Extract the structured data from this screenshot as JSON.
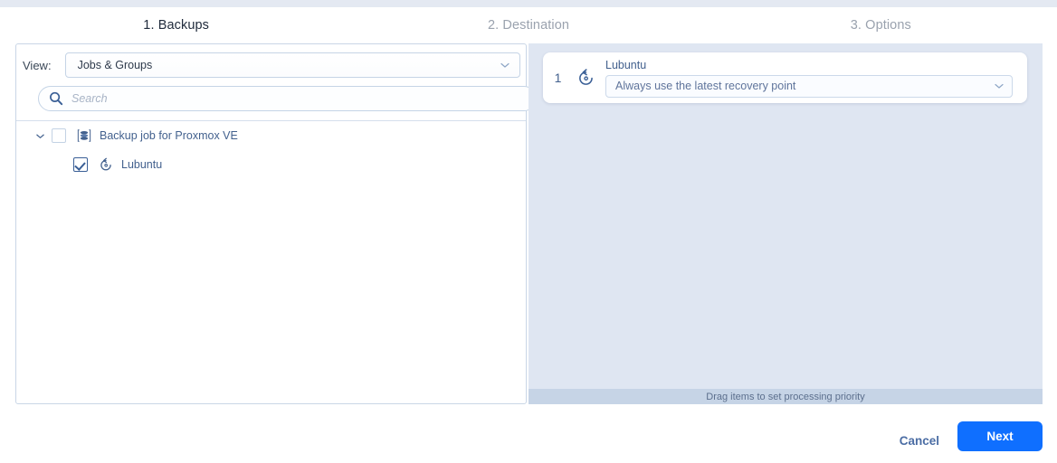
{
  "wizard": {
    "steps": [
      {
        "label": "1. Backups",
        "state": "active"
      },
      {
        "label": "2. Destination",
        "state": "inactive"
      },
      {
        "label": "3. Options",
        "state": "inactive"
      }
    ]
  },
  "left_pane": {
    "view": {
      "label": "View:",
      "selected": "Jobs & Groups"
    },
    "search": {
      "placeholder": "Search",
      "value": ""
    },
    "tree": [
      {
        "label": "Backup job for Proxmox VE",
        "icon": "backup-job-stack-icon",
        "checked": false,
        "expanded": true,
        "level": 0
      },
      {
        "label": "Lubuntu",
        "icon": "restore-point-icon",
        "checked": true,
        "level": 1
      }
    ]
  },
  "right_pane": {
    "items": [
      {
        "priority": "1",
        "icon": "restore-point-icon",
        "title": "Lubuntu",
        "recovery_point": "Always use the latest recovery point"
      }
    ],
    "drag_hint": "Drag items to set processing priority"
  },
  "footer": {
    "cancel_label": "Cancel",
    "next_label": "Next"
  },
  "colors": {
    "accent_blue": "#0f6fff",
    "link_blue": "#43618e",
    "pane_blue": "#dfe6f2",
    "hint_band": "#c6d4e6"
  }
}
